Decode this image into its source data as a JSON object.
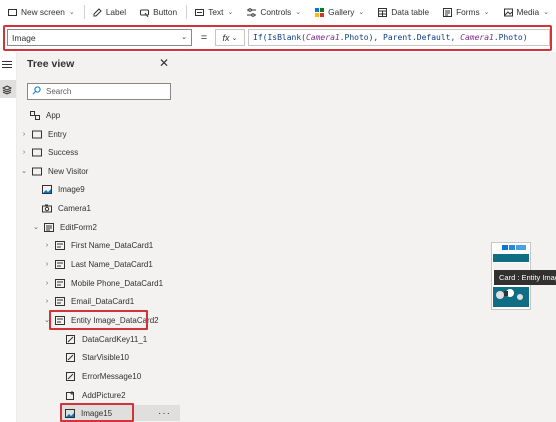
{
  "ribbon": {
    "items": [
      {
        "label": "New screen",
        "icon": "new-screen-icon",
        "dropdown": true
      },
      {
        "label": "Label",
        "icon": "label-icon",
        "dropdown": false
      },
      {
        "label": "Button",
        "icon": "button-icon",
        "dropdown": false
      },
      {
        "label": "Text",
        "icon": "text-icon",
        "dropdown": true
      },
      {
        "label": "Controls",
        "icon": "controls-icon",
        "dropdown": true
      },
      {
        "label": "Gallery",
        "icon": "gallery-icon",
        "dropdown": true
      },
      {
        "label": "Data table",
        "icon": "data-table-icon",
        "dropdown": false
      },
      {
        "label": "Forms",
        "icon": "forms-icon",
        "dropdown": true
      },
      {
        "label": "Media",
        "icon": "media-icon",
        "dropdown": true
      }
    ]
  },
  "formula_bar": {
    "property": "Image",
    "equals": "=",
    "fx": "fx",
    "formula_parts": [
      {
        "t": "fn",
        "v": "If(IsBlank("
      },
      {
        "t": "ctl",
        "v": "Camera1"
      },
      {
        "t": "fn",
        "v": ".Photo), Parent.Default, "
      },
      {
        "t": "ctl",
        "v": "Camera1"
      },
      {
        "t": "fn",
        "v": ".Photo)"
      }
    ]
  },
  "tree": {
    "title": "Tree view",
    "search_placeholder": "Search",
    "items": [
      {
        "label": "App",
        "icon": "app-icon",
        "caret": ""
      },
      {
        "label": "Entry",
        "icon": "screen-icon",
        "caret": "›"
      },
      {
        "label": "Success",
        "icon": "screen-icon",
        "caret": "›"
      },
      {
        "label": "New Visitor",
        "icon": "screen-icon",
        "caret": "⌄"
      },
      {
        "label": "Image9",
        "icon": "image-icon",
        "caret": ""
      },
      {
        "label": "Camera1",
        "icon": "camera-icon",
        "caret": ""
      },
      {
        "label": "EditForm2",
        "icon": "form-icon",
        "caret": "⌄"
      },
      {
        "label": "First Name_DataCard1",
        "icon": "datacard-icon",
        "caret": "›"
      },
      {
        "label": "Last Name_DataCard1",
        "icon": "datacard-icon",
        "caret": "›"
      },
      {
        "label": "Mobile Phone_DataCard1",
        "icon": "datacard-icon",
        "caret": "›"
      },
      {
        "label": "Email_DataCard1",
        "icon": "datacard-icon",
        "caret": "›"
      },
      {
        "label": "Entity Image_DataCard2",
        "icon": "datacard-icon",
        "caret": "⌄"
      },
      {
        "label": "DataCardKey11_1",
        "icon": "edit-label-icon",
        "caret": ""
      },
      {
        "label": "StarVisible10",
        "icon": "edit-label-icon",
        "caret": ""
      },
      {
        "label": "ErrorMessage10",
        "icon": "edit-label-icon",
        "caret": ""
      },
      {
        "label": "AddPicture2",
        "icon": "add-picture-icon",
        "caret": ""
      },
      {
        "label": "Image15",
        "icon": "image-icon",
        "caret": ""
      }
    ],
    "more": "···"
  },
  "canvas": {
    "tooltip": "Card : Entity Image"
  },
  "colors": {
    "highlight": "#d13438",
    "panel": "#f3f2f1",
    "selected": "#e1dfdd",
    "formula_text": "#0b3e8a",
    "control_ref": "#7d2b8c"
  }
}
